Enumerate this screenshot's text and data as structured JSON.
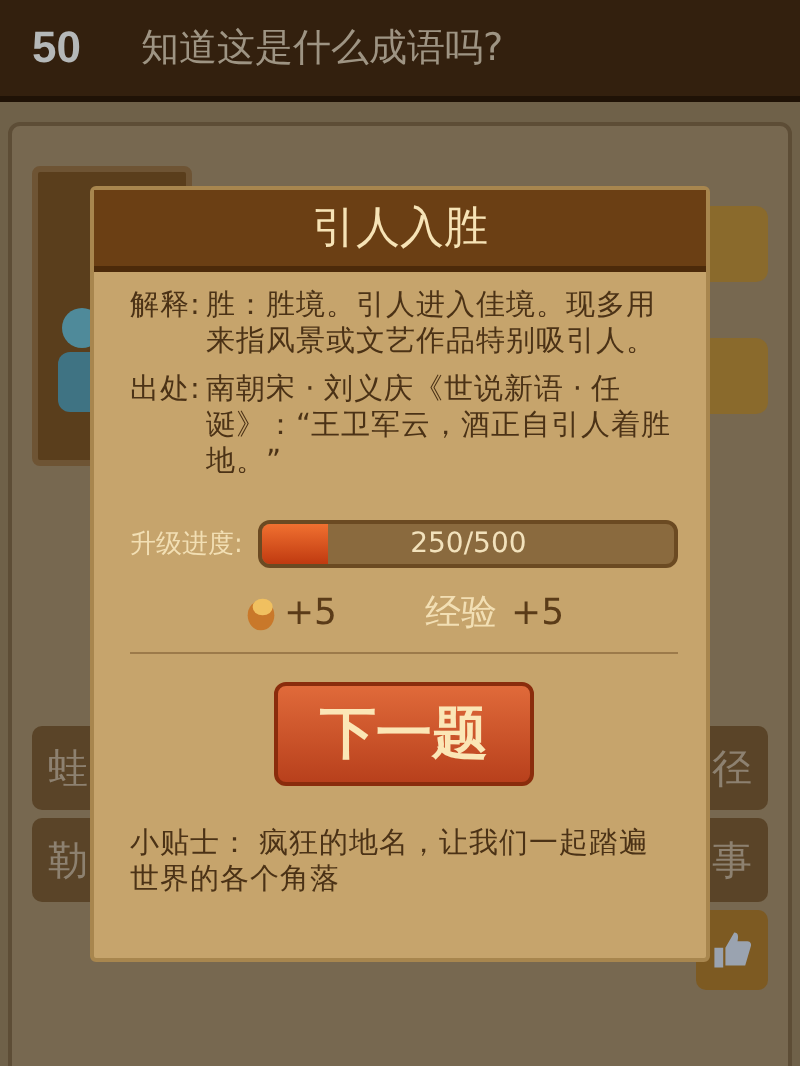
{
  "header": {
    "level": "50",
    "title": "知道这是什么成语吗?"
  },
  "background_tiles": [
    {
      "label": "蛙"
    },
    {
      "label": "径"
    },
    {
      "label": "勒"
    },
    {
      "label": "事"
    }
  ],
  "dialog": {
    "title": "引人入胜",
    "explanation": {
      "label": "解释:",
      "text": "胜：胜境。引人进入佳境。现多用来指风景或文艺作品特别吸引人。"
    },
    "source": {
      "label": "出处:",
      "text": "南朝宋 · 刘义庆《世说新语 · 任诞》：“王卫军云，酒正自引人着胜地。”"
    },
    "progress": {
      "label": "升级进度:",
      "level": 0.16,
      "reading": "250/500"
    },
    "rewards": [
      {
        "kind": "coin",
        "text": "+5"
      },
      {
        "kind": "experience",
        "label": "经验",
        "text": "+5"
      }
    ],
    "next_button": "下一题",
    "tip": "小贴士： 疯狂的地名，让我们一起踏遍世界的各个角落"
  }
}
